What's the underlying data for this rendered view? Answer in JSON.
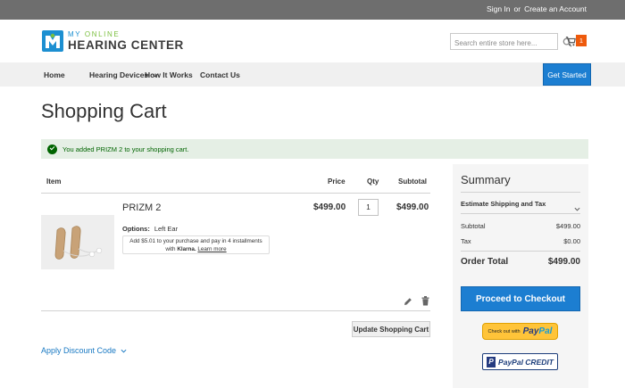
{
  "topbar": {
    "sign_in": "Sign In",
    "or": "or",
    "create_account": "Create an Account"
  },
  "logo": {
    "line1_a": "MY ",
    "line1_b": "ONLINE",
    "line2": "HEARING CENTER"
  },
  "search": {
    "placeholder": "Search entire store here..."
  },
  "cart": {
    "count": "1"
  },
  "nav": {
    "items": [
      {
        "label": "Home"
      },
      {
        "label": "Hearing Devices"
      },
      {
        "label": "How It Works"
      },
      {
        "label": "Contact Us"
      }
    ],
    "cta": "Get Started"
  },
  "page_title": "Shopping Cart",
  "message": "You added PRIZM 2 to your shopping cart.",
  "table": {
    "headers": {
      "item": "Item",
      "price": "Price",
      "qty": "Qty",
      "subtotal": "Subtotal"
    },
    "rows": [
      {
        "name": "PRIZM 2",
        "options_label": "Options:",
        "options_value": "Left Ear",
        "klarna_line1": "Add $5.01 to your purchase and pay in 4 installments",
        "klarna_with": "with ",
        "klarna_brand": "Klarna.",
        "klarna_link": "Learn more",
        "price": "$499.00",
        "qty": "1",
        "subtotal": "$499.00"
      }
    ]
  },
  "update_button": "Update Shopping Cart",
  "discount_label": "Apply Discount Code",
  "summary": {
    "title": "Summary",
    "estimate": "Estimate Shipping and Tax",
    "subtotal_label": "Subtotal",
    "subtotal_value": "$499.00",
    "tax_label": "Tax",
    "tax_value": "$0.00",
    "total_label": "Order Total",
    "total_value": "$499.00",
    "checkout": "Proceed to Checkout",
    "paypal_small": "Check out with",
    "paypal_a": "Pay",
    "paypal_b": "Pal",
    "credit_icon": "P",
    "credit_label": "PayPal CREDIT"
  },
  "colors": {
    "accent": "#1c7ed1",
    "topbar": "#6e6e6e",
    "cart_badge": "#ee5a0c",
    "success": "#006400"
  },
  "icons": [
    "logo-mark-icon",
    "search-icon",
    "cart-icon",
    "chevron-down-icon",
    "check-icon",
    "edit-icon",
    "trash-icon"
  ]
}
